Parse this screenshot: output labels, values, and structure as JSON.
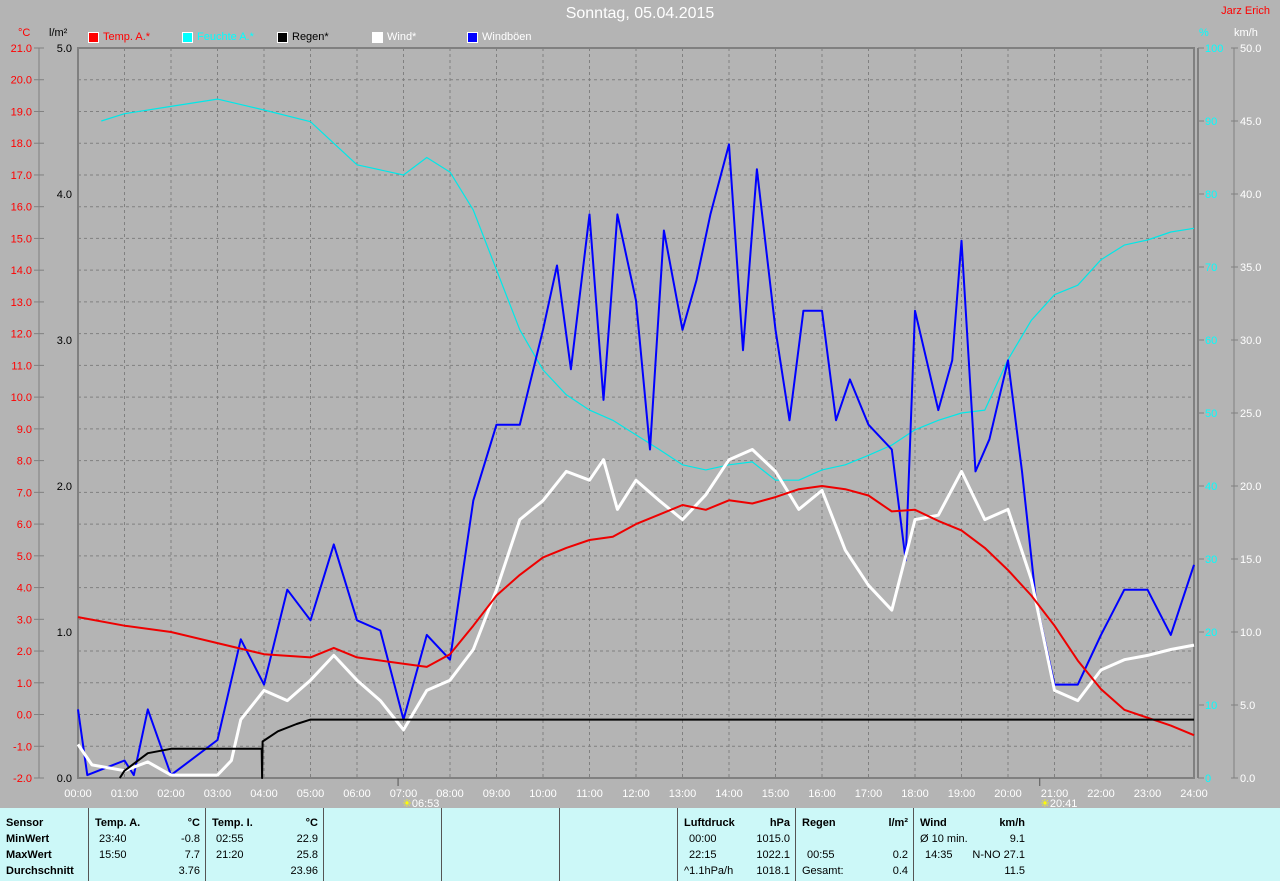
{
  "header": {
    "title": "Sonntag, 05.04.2015",
    "author": "Jarz Erich"
  },
  "legend": [
    {
      "label": "Temp. A.*",
      "color": "#ff0000"
    },
    {
      "label": "Feuchte A.*",
      "color": "#00ffff"
    },
    {
      "label": "Regen*",
      "color": "#000000"
    },
    {
      "label": "Wind*",
      "color": "#ffffff"
    },
    {
      "label": "Windböen",
      "color": "#0000ff"
    }
  ],
  "axes": {
    "temp_unit": "°C",
    "rain_unit": "l/m²",
    "hum_unit": "%",
    "wind_unit": "km/h"
  },
  "sun": {
    "sunrise": "06:53",
    "sunset": "20:41",
    "sunrise_h": 6.883,
    "sunset_h": 20.683
  },
  "chart_data": {
    "type": "line",
    "title": "Sonntag, 05.04.2015",
    "xlabel": "",
    "xlim": [
      0,
      24
    ],
    "x_ticks": [
      "00:00",
      "01:00",
      "02:00",
      "03:00",
      "04:00",
      "05:00",
      "06:00",
      "07:00",
      "08:00",
      "09:00",
      "10:00",
      "11:00",
      "12:00",
      "13:00",
      "14:00",
      "15:00",
      "16:00",
      "17:00",
      "18:00",
      "19:00",
      "20:00",
      "21:00",
      "22:00",
      "23:00",
      "24:00"
    ],
    "temp_axis": {
      "range": [
        -2,
        21
      ],
      "ticks": [
        "21.0",
        "20.0",
        "19.0",
        "18.0",
        "17.0",
        "16.0",
        "15.0",
        "14.0",
        "13.0",
        "12.0",
        "11.0",
        "10.0",
        "9.0",
        "8.0",
        "7.0",
        "6.0",
        "5.0",
        "4.0",
        "3.0",
        "2.0",
        "1.0",
        "0.0",
        "-1.0",
        "-2.0"
      ]
    },
    "rain_axis": {
      "range": [
        0,
        5
      ],
      "ticks": [
        "5.0",
        "4.0",
        "3.0",
        "2.0",
        "1.0",
        "0.0"
      ]
    },
    "hum_axis": {
      "range": [
        0,
        100
      ],
      "ticks": [
        "100",
        "90",
        "80",
        "70",
        "60",
        "50",
        "40",
        "30",
        "20",
        "10",
        "0"
      ]
    },
    "wind_axis": {
      "range": [
        0,
        50
      ],
      "ticks": [
        "50.0",
        "45.0",
        "40.0",
        "35.0",
        "30.0",
        "25.0",
        "20.0",
        "15.0",
        "10.0",
        "5.0",
        "0.0"
      ]
    },
    "grid": true,
    "series": [
      {
        "name": "Feuchte A.*",
        "axis": "hum",
        "color": "#00e8e8",
        "width": 1.2,
        "points": [
          [
            0.5,
            90
          ],
          [
            1,
            91
          ],
          [
            2,
            92
          ],
          [
            3,
            93
          ],
          [
            4,
            91.5
          ],
          [
            5,
            89.9
          ],
          [
            6,
            84
          ],
          [
            7,
            82.6
          ],
          [
            7.5,
            85
          ],
          [
            8,
            83
          ],
          [
            8.5,
            77.8
          ],
          [
            9,
            69.6
          ],
          [
            9.5,
            61.4
          ],
          [
            10,
            55.9
          ],
          [
            10.5,
            52.5
          ],
          [
            11,
            50.4
          ],
          [
            11.5,
            49
          ],
          [
            12,
            47
          ],
          [
            12.5,
            45
          ],
          [
            13,
            42.9
          ],
          [
            13.5,
            42.2
          ],
          [
            14,
            42.9
          ],
          [
            14.5,
            43.3
          ],
          [
            15,
            40.8
          ],
          [
            15.5,
            40.8
          ],
          [
            16,
            42.2
          ],
          [
            16.5,
            42.9
          ],
          [
            17,
            44.2
          ],
          [
            17.5,
            45.6
          ],
          [
            18,
            47.7
          ],
          [
            18.5,
            49
          ],
          [
            19,
            50
          ],
          [
            19.5,
            50.4
          ],
          [
            20,
            57.3
          ],
          [
            20.5,
            62.7
          ],
          [
            21,
            66.2
          ],
          [
            21.5,
            67.5
          ],
          [
            22,
            71
          ],
          [
            22.5,
            73
          ],
          [
            23,
            73.7
          ],
          [
            23.5,
            74.8
          ],
          [
            24,
            75.3
          ]
        ]
      },
      {
        "name": "Windböen",
        "axis": "wind",
        "color": "#0000ff",
        "width": 2,
        "points": [
          [
            0,
            4.7
          ],
          [
            0.2,
            0.2
          ],
          [
            1,
            1.2
          ],
          [
            1.2,
            0.2
          ],
          [
            1.5,
            4.7
          ],
          [
            2,
            0.2
          ],
          [
            3,
            2.6
          ],
          [
            3.5,
            9.5
          ],
          [
            4,
            6.4
          ],
          [
            4.5,
            12.9
          ],
          [
            5,
            10.8
          ],
          [
            5.5,
            16
          ],
          [
            6,
            10.8
          ],
          [
            6.5,
            10.1
          ],
          [
            7,
            4
          ],
          [
            7.5,
            9.8
          ],
          [
            8,
            8.1
          ],
          [
            8.5,
            19
          ],
          [
            9,
            24.2
          ],
          [
            9.5,
            24.2
          ],
          [
            10,
            30.7
          ],
          [
            10.3,
            35.1
          ],
          [
            10.6,
            28
          ],
          [
            11,
            38.6
          ],
          [
            11.3,
            25.9
          ],
          [
            11.6,
            38.6
          ],
          [
            12,
            32.7
          ],
          [
            12.3,
            22.5
          ],
          [
            12.6,
            37.5
          ],
          [
            13,
            30.7
          ],
          [
            13.3,
            34.1
          ],
          [
            13.6,
            38.6
          ],
          [
            14,
            43.4
          ],
          [
            14.3,
            29.3
          ],
          [
            14.6,
            41.7
          ],
          [
            15,
            30.7
          ],
          [
            15.3,
            24.5
          ],
          [
            15.6,
            32
          ],
          [
            16,
            32
          ],
          [
            16.3,
            24.5
          ],
          [
            16.6,
            27.3
          ],
          [
            17,
            24.2
          ],
          [
            17.5,
            22.5
          ],
          [
            17.8,
            14.9
          ],
          [
            18,
            32
          ],
          [
            18.5,
            25.2
          ],
          [
            18.8,
            28.6
          ],
          [
            19,
            36.8
          ],
          [
            19.3,
            21
          ],
          [
            19.6,
            23.2
          ],
          [
            20,
            28.6
          ],
          [
            20.3,
            21
          ],
          [
            20.6,
            12.2
          ],
          [
            21,
            6.4
          ],
          [
            21.5,
            6.4
          ],
          [
            22,
            9.8
          ],
          [
            22.5,
            12.9
          ],
          [
            23,
            12.9
          ],
          [
            23.5,
            9.8
          ],
          [
            24,
            14.6
          ]
        ]
      },
      {
        "name": "Wind*",
        "axis": "wind",
        "color": "#ffffff",
        "width": 3,
        "points": [
          [
            0,
            2.3
          ],
          [
            0.3,
            0.9
          ],
          [
            1,
            0.5
          ],
          [
            1.5,
            1.1
          ],
          [
            2,
            0.2
          ],
          [
            3,
            0.2
          ],
          [
            3.3,
            1.2
          ],
          [
            3.5,
            4
          ],
          [
            4,
            6
          ],
          [
            4.5,
            5.3
          ],
          [
            5,
            6.7
          ],
          [
            5.5,
            8.4
          ],
          [
            6,
            6.7
          ],
          [
            6.5,
            5.3
          ],
          [
            7,
            3.3
          ],
          [
            7.5,
            6
          ],
          [
            8,
            6.7
          ],
          [
            8.5,
            8.8
          ],
          [
            9,
            12.9
          ],
          [
            9.5,
            17.7
          ],
          [
            10,
            19
          ],
          [
            10.5,
            21
          ],
          [
            11,
            20.4
          ],
          [
            11.3,
            21.8
          ],
          [
            11.6,
            18.4
          ],
          [
            12,
            20.4
          ],
          [
            12.5,
            19
          ],
          [
            13,
            17.7
          ],
          [
            13.5,
            19.4
          ],
          [
            14,
            21.8
          ],
          [
            14.5,
            22.5
          ],
          [
            15,
            21
          ],
          [
            15.5,
            18.4
          ],
          [
            16,
            19.7
          ],
          [
            16.5,
            15.6
          ],
          [
            17,
            13.2
          ],
          [
            17.5,
            11.5
          ],
          [
            18,
            17.7
          ],
          [
            18.5,
            18
          ],
          [
            19,
            21
          ],
          [
            19.5,
            17.7
          ],
          [
            20,
            18.4
          ],
          [
            20.5,
            13.6
          ],
          [
            21,
            6
          ],
          [
            21.5,
            5.3
          ],
          [
            22,
            7.4
          ],
          [
            22.5,
            8.1
          ],
          [
            23,
            8.4
          ],
          [
            23.5,
            8.8
          ],
          [
            24,
            9.1
          ]
        ]
      },
      {
        "name": "Temp. A.*",
        "axis": "temp",
        "color": "#ee0000",
        "width": 2,
        "points": [
          [
            0,
            3.07
          ],
          [
            1,
            2.8
          ],
          [
            2,
            2.6
          ],
          [
            3,
            2.25
          ],
          [
            4,
            1.9
          ],
          [
            5,
            1.8
          ],
          [
            5.5,
            2.1
          ],
          [
            6,
            1.8
          ],
          [
            7,
            1.6
          ],
          [
            7.5,
            1.5
          ],
          [
            8,
            1.9
          ],
          [
            8.5,
            2.8
          ],
          [
            9,
            3.75
          ],
          [
            9.5,
            4.4
          ],
          [
            10,
            4.95
          ],
          [
            10.5,
            5.25
          ],
          [
            11,
            5.5
          ],
          [
            11.5,
            5.6
          ],
          [
            12,
            6
          ],
          [
            12.5,
            6.3
          ],
          [
            13,
            6.6
          ],
          [
            13.5,
            6.45
          ],
          [
            14,
            6.75
          ],
          [
            14.5,
            6.65
          ],
          [
            15,
            6.85
          ],
          [
            15.5,
            7.1
          ],
          [
            16,
            7.2
          ],
          [
            16.5,
            7.1
          ],
          [
            17,
            6.9
          ],
          [
            17.5,
            6.4
          ],
          [
            18,
            6.45
          ],
          [
            18.5,
            6.1
          ],
          [
            19,
            5.8
          ],
          [
            19.5,
            5.25
          ],
          [
            20,
            4.55
          ],
          [
            20.5,
            3.75
          ],
          [
            21,
            2.8
          ],
          [
            21.5,
            1.7
          ],
          [
            22,
            0.8
          ],
          [
            22.5,
            0.15
          ],
          [
            23,
            -0.1
          ],
          [
            23.5,
            -0.35
          ],
          [
            24,
            -0.65
          ]
        ]
      },
      {
        "name": "Regen*",
        "axis": "rain",
        "color": "#000000",
        "width": 2,
        "points": [
          [
            0.9,
            0
          ],
          [
            1,
            0.05
          ],
          [
            1.5,
            0.17
          ],
          [
            2,
            0.2
          ],
          [
            3.95,
            0.2
          ],
          [
            3.96,
            0
          ],
          [
            3.97,
            0.25
          ],
          [
            4.3,
            0.32
          ],
          [
            4.7,
            0.37
          ],
          [
            5,
            0.4
          ],
          [
            24,
            0.4
          ]
        ]
      }
    ]
  },
  "table": {
    "sensor": {
      "h": "Sensor",
      "min": "MinWert",
      "max": "MaxWert",
      "avg": "Durchschnitt"
    },
    "temp_a": {
      "h": "Temp. A.",
      "u": "°C",
      "min_t": "23:40",
      "min": "-0.8",
      "max_t": "15:50",
      "max": "7.7",
      "avg": "3.76"
    },
    "temp_i": {
      "h": "Temp. I.",
      "u": "°C",
      "min_t": "02:55",
      "min": "22.9",
      "max_t": "21:20",
      "max": "25.8",
      "avg": "23.96"
    },
    "pressure": {
      "h": "Luftdruck",
      "u": "hPa",
      "r1a": "00:00",
      "r1b": "1015.0",
      "r2a": "22:15",
      "r2b": "1022.1",
      "r3a": "^1.1hPa/h",
      "r3b": "1018.1"
    },
    "rain": {
      "h": "Regen",
      "u": "l/m²",
      "r2a": "00:55",
      "r2b": "0.2",
      "r3a": "Gesamt:",
      "r3b": "0.4"
    },
    "wind": {
      "h": "Wind",
      "u": "km/h",
      "r1a": "Ø 10 min.",
      "r1b": "9.1",
      "r2a": "14:35",
      "r2b": "N-NO 27.1",
      "r3b": "11.5"
    }
  }
}
